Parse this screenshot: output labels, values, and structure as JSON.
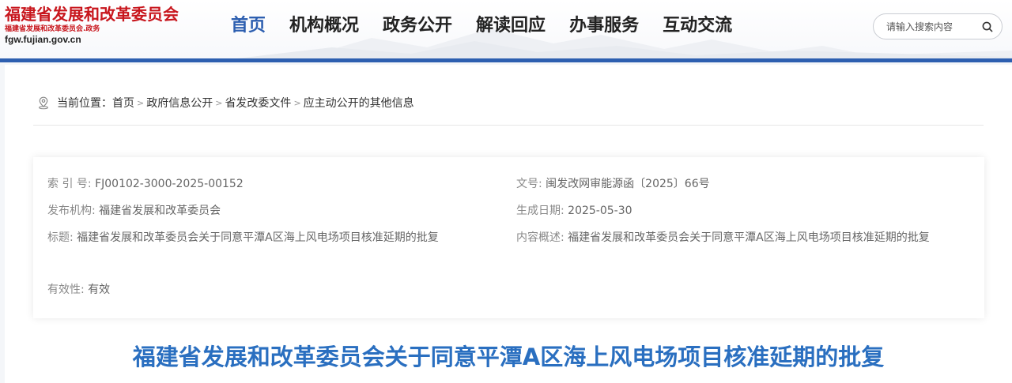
{
  "header": {
    "logo": {
      "title": "福建省发展和改革委员会",
      "subtitle": "福建省发展和改革委员会.政务",
      "url": "fgw.fujian.gov.cn"
    },
    "nav": [
      "首页",
      "机构概况",
      "政务公开",
      "解读回应",
      "办事服务",
      "互动交流"
    ],
    "active_nav": "首页",
    "search": {
      "placeholder": "请输入搜索内容"
    },
    "colors": {
      "brand_red": "#c8161d",
      "accent_blue": "#2d5fb0"
    }
  },
  "breadcrumb": {
    "label": "当前位置：",
    "items": [
      "首页",
      "政府信息公开",
      "省发改委文件",
      "应主动公开的其他信息"
    ],
    "separator": ">"
  },
  "meta": {
    "index_no": {
      "label": "索 引 号:",
      "value": "FJ00102-3000-2025-00152"
    },
    "doc_no": {
      "label": "文号:",
      "value": "闽发改网审能源函〔2025〕66号"
    },
    "publisher": {
      "label": "发布机构:",
      "value": "福建省发展和改革委员会"
    },
    "date": {
      "label": "生成日期:",
      "value": "2025-05-30"
    },
    "title": {
      "label": "标题:",
      "value": "福建省发展和改革委员会关于同意平潭A区海上风电场项目核准延期的批复"
    },
    "summary": {
      "label": "内容概述:",
      "value": "福建省发展和改革委员会关于同意平潭A区海上风电场项目核准延期的批复"
    },
    "validity": {
      "label": "有效性:",
      "value": "有效"
    }
  },
  "document": {
    "title": "福建省发展和改革委员会关于同意平潭A区海上风电场项目核准延期的批复",
    "title_color": "#2a6fc0"
  }
}
